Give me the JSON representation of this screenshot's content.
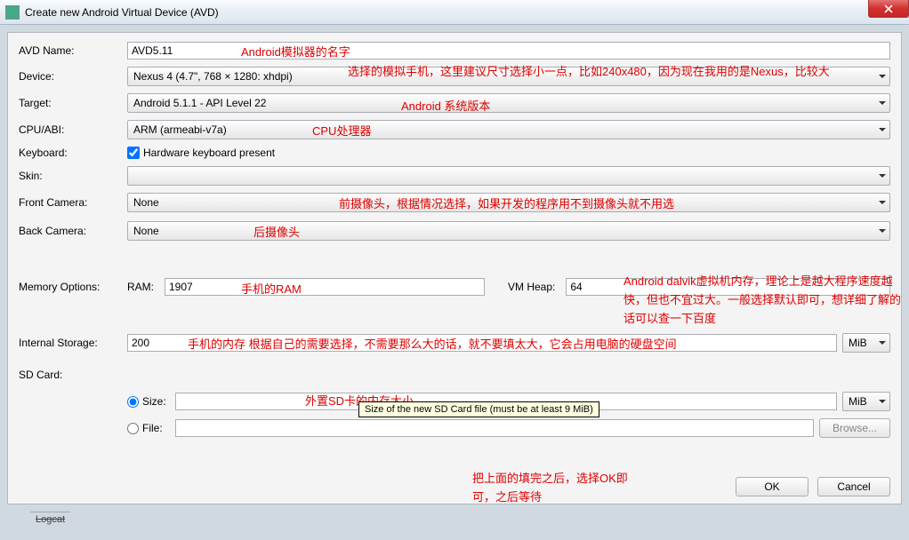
{
  "window": {
    "title": "Create new Android Virtual Device (AVD)"
  },
  "labels": {
    "avd_name": "AVD Name:",
    "device": "Device:",
    "target": "Target:",
    "cpu_abi": "CPU/ABI:",
    "keyboard": "Keyboard:",
    "skin": "Skin:",
    "front_camera": "Front Camera:",
    "back_camera": "Back Camera:",
    "memory_options": "Memory Options:",
    "ram": "RAM:",
    "vm_heap": "VM Heap:",
    "internal_storage": "Internal Storage:",
    "sd_card": "SD Card:",
    "size": "Size:",
    "file": "File:"
  },
  "values": {
    "avd_name": "AVD5.11",
    "device": "Nexus 4 (4.7\", 768 × 1280: xhdpi)",
    "target": "Android 5.1.1 - API Level 22",
    "cpu_abi": "ARM (armeabi-v7a)",
    "skin": "",
    "front_camera": "None",
    "back_camera": "None",
    "ram": "1907",
    "vm_heap": "64",
    "internal_storage": "200",
    "storage_unit": "MiB",
    "sd_size": "",
    "sd_size_unit": "MiB",
    "sd_file": ""
  },
  "checkbox": {
    "keyboard_label": "Hardware keyboard present",
    "keyboard_checked": true
  },
  "buttons": {
    "browse": "Browse...",
    "ok": "OK",
    "cancel": "Cancel"
  },
  "tooltip": {
    "sd_size": "Size of the new SD Card file (must be at least 9 MiB)"
  },
  "annotations": {
    "avd_name": "Android模拟器的名字",
    "device": "选择的模拟手机，这里建议尺寸选择小一点，比如240x480，因为现在我用的是Nexus，比较大",
    "target": "Android 系统版本",
    "cpu_abi": "CPU处理器",
    "front_camera": "前摄像头，根据情况选择，如果开发的程序用不到摄像头就不用选",
    "back_camera": "后摄像头",
    "ram": "手机的RAM",
    "vm_heap": "Android dalvik虚拟机内存，理论上是越大程序速度越快，但也不宜过大。一般选择默认即可，想详细了解的话可以查一下百度",
    "internal_storage": "手机的内存  根据自己的需要选择，不需要那么大的话，就不要填太大，它会占用电脑的硬盘空间",
    "sd_size": "外置SD卡的内存大小",
    "final": "把上面的填完之后，选择OK即可，之后等待"
  },
  "taskbar": {
    "item": "Logcat"
  }
}
